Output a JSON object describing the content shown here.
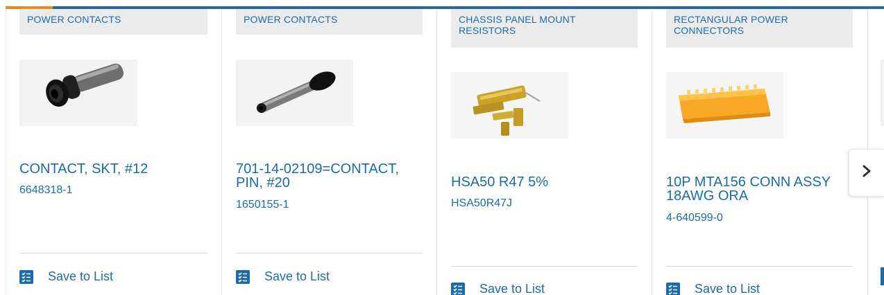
{
  "carousel": {
    "cards": [
      {
        "category": "POWER CONTACTS",
        "image": "black-socket-contact",
        "title": "CONTACT, SKT, #12",
        "part_number": "6648318-1",
        "save_label": "Save to List"
      },
      {
        "category": "POWER CONTACTS",
        "image": "pin-contact",
        "title": "701-14-02109=CONTACT, PIN, #20",
        "part_number": "1650155-1",
        "save_label": "Save to List"
      },
      {
        "category": "CHASSIS PANEL MOUNT RESISTORS",
        "image": "gold-resistors",
        "title": "HSA50 R47 5%",
        "part_number": "HSA50R47J",
        "save_label": "Save to List"
      },
      {
        "category": "RECTANGULAR POWER CONNECTORS",
        "image": "orange-connector",
        "title": "10P MTA156 CONN ASSY 18AWG ORA",
        "part_number": "4-640599-0",
        "save_label": "Save to List"
      }
    ],
    "next_icon": "chevron-right-icon",
    "save_icon": "checklist-icon"
  },
  "colors": {
    "brand_blue": "#1b6bab",
    "accent_orange": "#ec8b1c",
    "category_bg": "#ebebeb"
  }
}
